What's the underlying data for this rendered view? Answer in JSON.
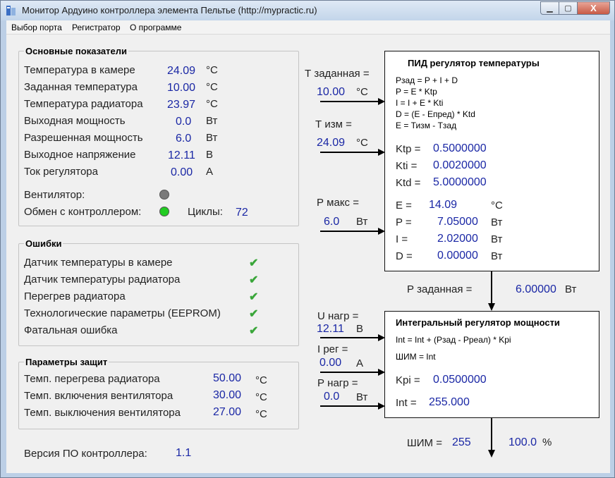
{
  "window": {
    "title": "Монитор Ардуино контроллера элемента Пельтье (http://mypractic.ru)",
    "minimize_glyph": "▁",
    "maximize_glyph": "▢",
    "close_glyph": "X"
  },
  "menu": {
    "items": [
      "Выбор порта",
      "Регистратор",
      "О программе"
    ]
  },
  "main": {
    "title": "Основные показатели",
    "rows": [
      {
        "label": "Температура в камере",
        "value": "24.09",
        "unit": "°C"
      },
      {
        "label": "Заданная температура",
        "value": "10.00",
        "unit": "°C"
      },
      {
        "label": "Температура радиатора",
        "value": "23.97",
        "unit": "°C"
      },
      {
        "label": "Выходная мощность",
        "value": "0.0",
        "unit": "Вт"
      },
      {
        "label": "Разрешенная мощность",
        "value": "6.0",
        "unit": "Вт"
      },
      {
        "label": "Выходное напряжение",
        "value": "12.11",
        "unit": "В"
      },
      {
        "label": "Ток регулятора",
        "value": "0.00",
        "unit": "А"
      }
    ],
    "fan_label": "Вентилятор:",
    "fan_color": "#7a7a7a",
    "exchange_label": "Обмен с контроллером:",
    "exchange_color": "#22cc22",
    "cycles_label": "Циклы:",
    "cycles_value": "72"
  },
  "errors": {
    "title": "Ошибки",
    "items": [
      "Датчик температуры в камере",
      "Датчик температуры радиатора",
      "Перегрев радиатора",
      "Технологические параметры (EEPROM)",
      "Фатальная ошибка"
    ],
    "check_glyph": "✔"
  },
  "protection": {
    "title": "Параметры защит",
    "rows": [
      {
        "label": "Темп. перегрева радиатора",
        "value": "50.00",
        "unit": "°C"
      },
      {
        "label": "Темп. включения вентилятора",
        "value": "30.00",
        "unit": "°C"
      },
      {
        "label": "Темп. выключения вентилятора",
        "value": "27.00",
        "unit": "°C"
      }
    ]
  },
  "firmware": {
    "label": "Версия ПО контроллера:",
    "value": "1.1"
  },
  "pid_inputs": {
    "t_set_label": "Т заданная =",
    "t_set_value": "10.00",
    "t_set_unit": "°C",
    "t_meas_label": "Т изм =",
    "t_meas_value": "24.09",
    "t_meas_unit": "°C",
    "p_max_label": "Р макс =",
    "p_max_value": "6.0",
    "p_max_unit": "Вт"
  },
  "pid": {
    "title": "ПИД регулятор температуры",
    "formulas": [
      "Рзад = P + I + D",
      "P = E * Ktp",
      "I = I + E * Kti",
      "D = (E - Епред) * Ktd",
      "E = Тизм - Тзад"
    ],
    "coeffs": [
      {
        "label": "Ktp =",
        "value": "0.5000000"
      },
      {
        "label": "Kti =",
        "value": "0.0020000"
      },
      {
        "label": "Ktd =",
        "value": "5.0000000"
      }
    ],
    "outputs": [
      {
        "label": "E =",
        "value": "14.09",
        "unit": "°C"
      },
      {
        "label": "P =",
        "value": "7.05000",
        "unit": "Вт"
      },
      {
        "label": "I =",
        "value": "2.02000",
        "unit": "Вт"
      },
      {
        "label": "D =",
        "value": "0.00000",
        "unit": "Вт"
      }
    ]
  },
  "p_set": {
    "label": "Р заданная =",
    "value": "6.00000",
    "unit": "Вт"
  },
  "int_inputs": {
    "u_label": "U нагр =",
    "u_value": "12.11",
    "u_unit": "В",
    "i_label": "I рег =",
    "i_value": "0.00",
    "i_unit": "А",
    "p_label": "Р нагр =",
    "p_value": "0.0",
    "p_unit": "Вт"
  },
  "integral": {
    "title": "Интегральный регулятор мощности",
    "formulas": [
      "Int = Int + (Рзад - Рреал) * Kpi",
      "ШИМ = Int"
    ],
    "kpi_label": "Kpi =",
    "kpi_value": "0.0500000",
    "int_label": "Int =",
    "int_value": "255.000"
  },
  "pwm": {
    "label": "ШИМ =",
    "value": "255",
    "percent_value": "100.0",
    "percent_sign": "%"
  }
}
